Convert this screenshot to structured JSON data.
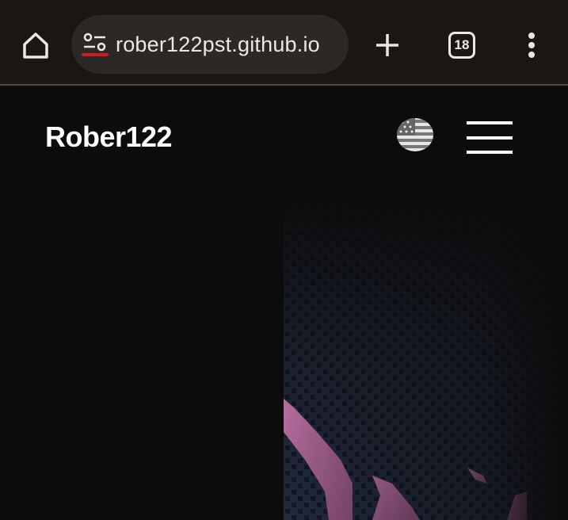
{
  "browser": {
    "url": "rober122pst.github.io",
    "tab_count": "18",
    "icons": [
      "home-icon",
      "site-settings-icon",
      "new-tab-icon",
      "tab-switcher-icon",
      "more-options-icon"
    ],
    "accent_color": "#d01c1c"
  },
  "site": {
    "logo": "Rober122",
    "language_icon": "us-flag-icon",
    "menu_icon": "hamburger-menu-icon",
    "hero_colors": {
      "pixel": "#1f2637",
      "pink": "#b06a9c",
      "background": "#0c0c0c"
    }
  }
}
